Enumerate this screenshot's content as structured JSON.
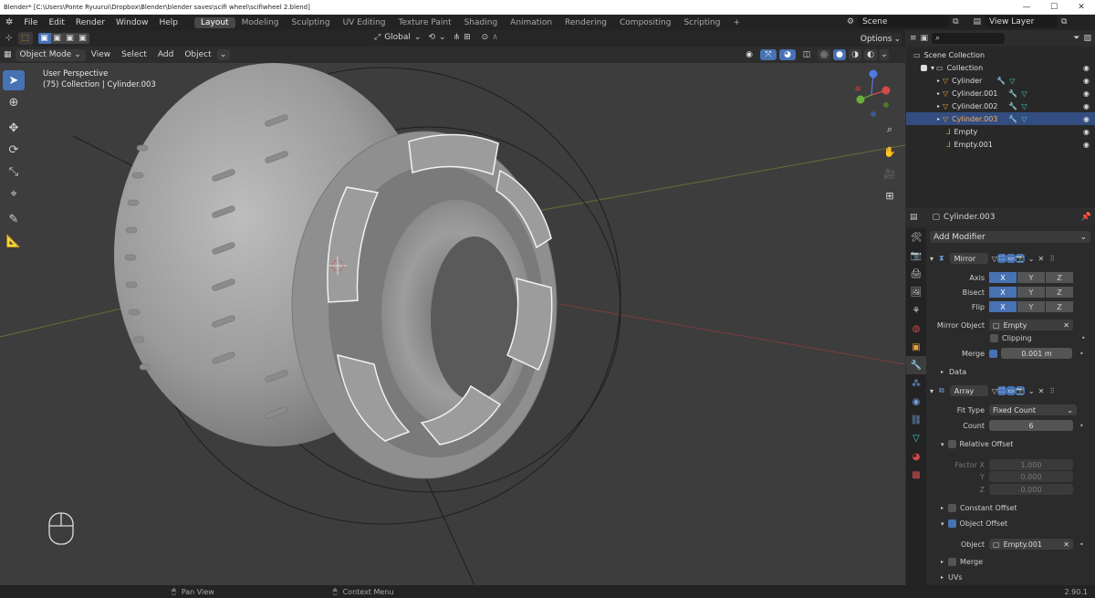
{
  "titlebar": {
    "title": "Blender* [C:\\Users\\Ponte Ryuurui\\Dropbox\\Blender\\blender saves\\scifi wheel\\scifiwheel 2.blend]"
  },
  "menu": [
    "File",
    "Edit",
    "Render",
    "Window",
    "Help"
  ],
  "workspaces": [
    {
      "label": "Layout",
      "active": true
    },
    {
      "label": "Modeling"
    },
    {
      "label": "Sculpting"
    },
    {
      "label": "UV Editing"
    },
    {
      "label": "Texture Paint"
    },
    {
      "label": "Shading"
    },
    {
      "label": "Animation"
    },
    {
      "label": "Rendering"
    },
    {
      "label": "Compositing"
    },
    {
      "label": "Scripting"
    }
  ],
  "scene": {
    "label": "Scene",
    "view_layer": "View Layer"
  },
  "viewport_header": {
    "mode": "Object Mode",
    "menus": [
      "View",
      "Select",
      "Add",
      "Object"
    ],
    "orientation": "Global",
    "options": "Options"
  },
  "viewport": {
    "perspective": "User Perspective",
    "collection_info": "(75) Collection | Cylinder.003"
  },
  "outliner": {
    "search_placeholder": "",
    "rows": [
      {
        "label": "Scene Collection",
        "indent": 0
      },
      {
        "label": "Collection",
        "indent": 1
      },
      {
        "label": "Cylinder",
        "indent": 2
      },
      {
        "label": "Cylinder.001",
        "indent": 2
      },
      {
        "label": "Cylinder.002",
        "indent": 2
      },
      {
        "label": "Cylinder.003",
        "indent": 2,
        "selected": true
      },
      {
        "label": "Empty",
        "indent": 2
      },
      {
        "label": "Empty.001",
        "indent": 2
      }
    ]
  },
  "properties": {
    "object_name": "Cylinder.003",
    "add_modifier": "Add Modifier",
    "mirror": {
      "name": "Mirror",
      "axis_label": "Axis",
      "bisect_label": "Bisect",
      "flip_label": "Flip",
      "x": "X",
      "y": "Y",
      "z": "Z",
      "mirror_object_label": "Mirror Object",
      "mirror_object": "Empty",
      "clipping_label": "Clipping",
      "merge_label": "Merge",
      "merge_value": "0.001 m",
      "data_label": "Data"
    },
    "array": {
      "name": "Array",
      "fit_type_label": "Fit Type",
      "fit_type": "Fixed Count",
      "count_label": "Count",
      "count": "6",
      "relative_offset_label": "Relative Offset",
      "factor_x_label": "Factor X",
      "y_label": "Y",
      "z_label": "Z",
      "factor_x": "1.000",
      "factor_y": "0.000",
      "factor_z": "0.000",
      "constant_offset_label": "Constant Offset",
      "object_offset_label": "Object Offset",
      "object_label": "Object",
      "object": "Empty.001",
      "merge_label": "Merge",
      "uvs_label": "UVs"
    }
  },
  "statusbar": {
    "pan_view": "Pan View",
    "context_menu": "Context Menu",
    "version": "2.90.1"
  },
  "colors": {
    "accent": "#4772b3",
    "selection": "#334d80",
    "header": "#232323"
  }
}
